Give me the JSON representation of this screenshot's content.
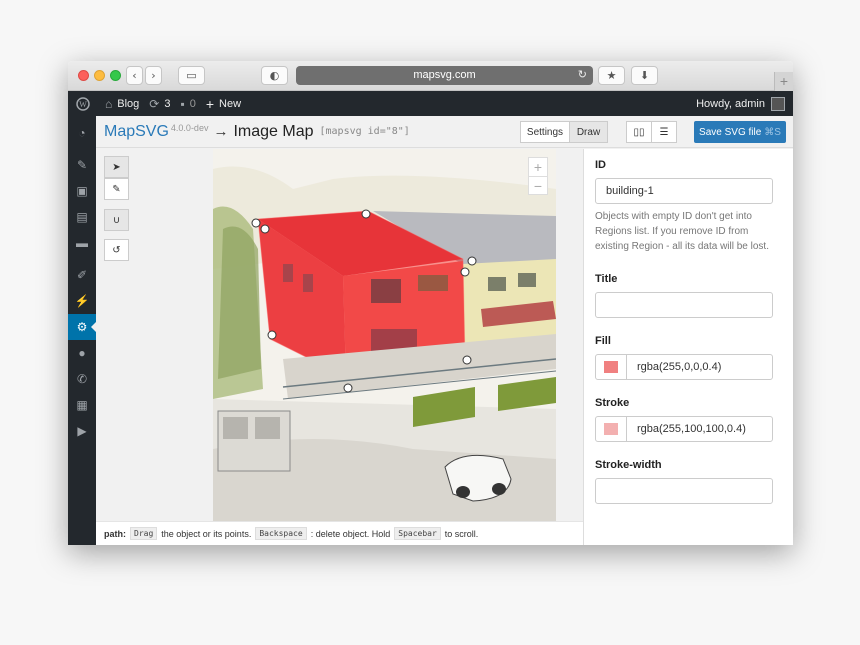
{
  "browser": {
    "url": "mapsvg.com"
  },
  "adminbar": {
    "site_name": "Blog",
    "updates_count": "3",
    "comments_count": "0",
    "new_label": "New",
    "howdy": "Howdy, admin"
  },
  "header": {
    "brand": "MapSVG",
    "version": "4.0.0-dev",
    "arrow": "→",
    "map_title": "Image Map",
    "shortcode": "[mapsvg id=\"8\"]",
    "settings_label": "Settings",
    "draw_label": "Draw",
    "save_label": "Save SVG file",
    "save_shortcut": "⌘S"
  },
  "statusbar": {
    "mode": "path:",
    "key_drag": "Drag",
    "text1": "the object or its points.",
    "key_backspace": "Backspace",
    "text2": ": delete object. Hold",
    "key_space": "Spacebar",
    "text3": "to scroll."
  },
  "panel": {
    "id_label": "ID",
    "id_value": "building-1",
    "id_help": "Objects with empty ID don't get into Regions list. If you remove ID from existing Region - all its data will be lost.",
    "title_label": "Title",
    "title_value": "",
    "fill_label": "Fill",
    "fill_value": "rgba(255,0,0,0.4)",
    "stroke_label": "Stroke",
    "stroke_value": "rgba(255,100,100,0.4)",
    "stroke_width_label": "Stroke-width",
    "stroke_width_value": ""
  },
  "colors": {
    "accent": "#2a7ab8",
    "admin_bar": "#23282d",
    "fill_swatch": "#f08080",
    "stroke_swatch": "#f3b0b0"
  }
}
